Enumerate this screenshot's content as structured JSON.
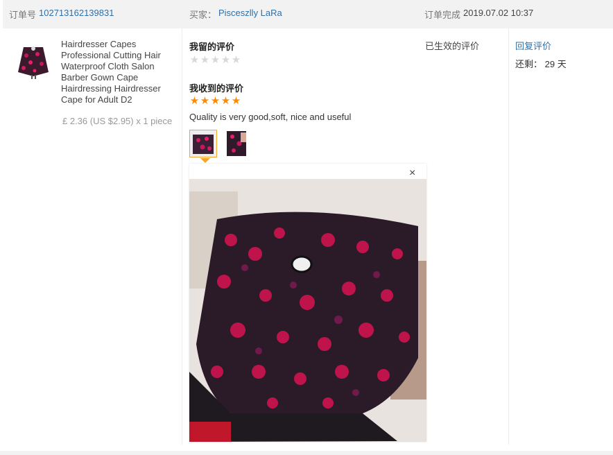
{
  "order": {
    "number_label": "订单号",
    "number": "102713162139831",
    "buyer_label": "买家：",
    "buyer": "Pisceszlly LaRa",
    "completed_label": "订单完成",
    "completed_time": "2019.07.02 10:37"
  },
  "product": {
    "title": "Hairdresser Capes Professional Cutting Hair Waterproof Cloth Salon Barber Gown Cape Hairdressing Hairdresser Cape for Adult D2",
    "price": "£ 2.36 (US $2.95) x 1 piece",
    "thumb_icon": "cape-product-thumbnail"
  },
  "feedback": {
    "left_title": "我留的评价",
    "left_rating": 0,
    "received_title": "我收到的评价",
    "received_rating": 5,
    "comment": "Quality is very good,soft, nice and useful",
    "photos": [
      "review-photo-1",
      "review-photo-2"
    ],
    "status": "已生效的评价"
  },
  "viewer": {
    "close_symbol": "×",
    "image": "red-rose-print-cape-photo"
  },
  "actions": {
    "reply_label": "回复评价",
    "remaining_label": "还剩：",
    "remaining_value": "29 天"
  },
  "colors": {
    "link": "#2f6fa8",
    "star": "#ff8a00",
    "selected_border": "#f7a42c"
  }
}
